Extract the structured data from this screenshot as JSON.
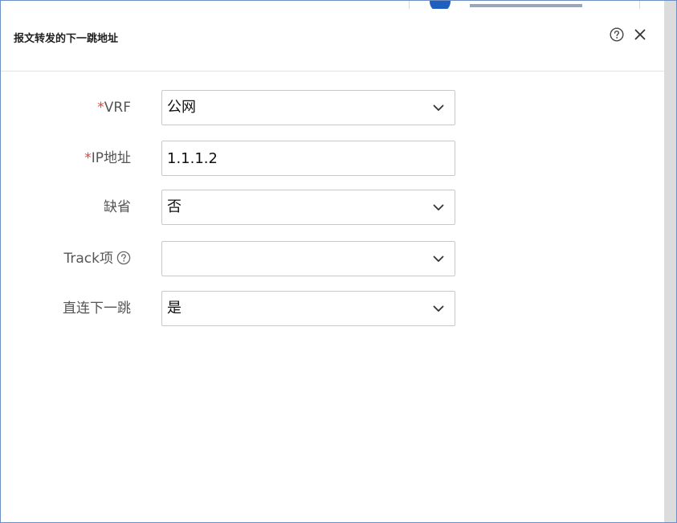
{
  "dialog": {
    "title": "报文转发的下一跳地址"
  },
  "form": {
    "vrf": {
      "required_mark": "*",
      "label": "VRF",
      "value": "公网"
    },
    "ip": {
      "required_mark": "*",
      "label": "IP地址",
      "value": "1.1.1.2"
    },
    "default": {
      "label": "缺省",
      "value": "否"
    },
    "track": {
      "label": "Track项",
      "value": ""
    },
    "direct_next_hop": {
      "label": "直连下一跳",
      "value": "是"
    }
  },
  "icons": {
    "help": "help-icon",
    "close": "close-icon",
    "chevron": "chevron-down-icon"
  },
  "colors": {
    "required": "#e0433a",
    "border": "#c9c9c9",
    "frame": "#6d8fc4"
  }
}
